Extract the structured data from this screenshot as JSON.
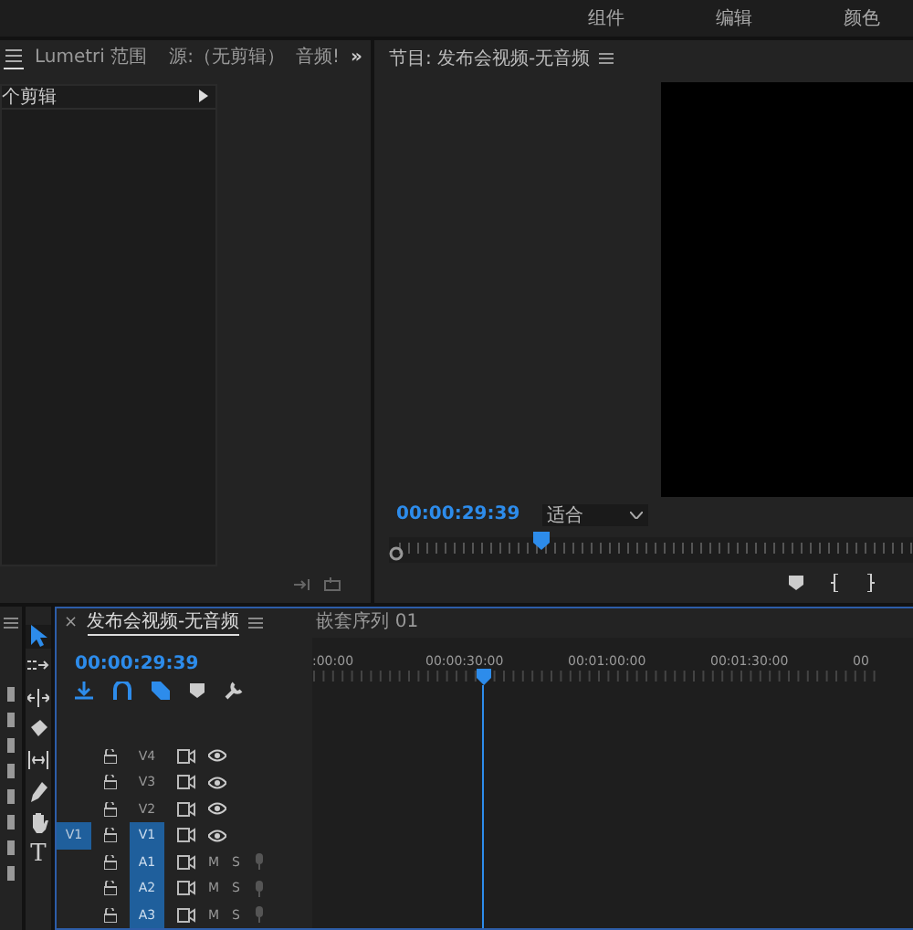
{
  "workspace_tabs": [
    "组件",
    "编辑",
    "颜色"
  ],
  "left_panel": {
    "tabs": [
      {
        "kind": "menu",
        "selected": true
      },
      {
        "kind": "text",
        "label": "Lumetri 范围",
        "selected": false
      },
      {
        "kind": "text",
        "label": "源:（无剪辑）",
        "selected": false
      },
      {
        "kind": "text",
        "label": "音频!",
        "selected": false
      }
    ],
    "overflow": "»",
    "list_header": "个剪辑"
  },
  "program": {
    "title": "节目: 发布会视频-无音频",
    "timecode": "00:00:29:39",
    "zoom": "适合",
    "playhead": {
      "level": 0.29
    }
  },
  "tools": [
    {
      "kind": "select",
      "selected": true
    },
    {
      "kind": "track",
      "selected": false
    },
    {
      "kind": "ripple",
      "selected": false
    },
    {
      "kind": "razor",
      "selected": false
    },
    {
      "kind": "slip",
      "selected": false
    },
    {
      "kind": "pen",
      "selected": false
    },
    {
      "kind": "hand",
      "selected": false
    },
    {
      "kind": "type",
      "glyph": "T",
      "selected": false
    }
  ],
  "timeline": {
    "tabs": [
      {
        "label": "发布会视频-无音频",
        "selected": true,
        "close": "×"
      },
      {
        "label": "嵌套序列 01",
        "selected": false
      }
    ],
    "timecode": "00:00:29:39",
    "ruler": [
      ":00:00",
      "00:00:30:00",
      "00:01:00:00",
      "00:01:30:00",
      "00"
    ],
    "playhead": {
      "level": 0.25
    },
    "tracks": [
      {
        "kind": "video",
        "label": "V4",
        "targeted": false
      },
      {
        "kind": "video",
        "label": "V3",
        "targeted": false
      },
      {
        "kind": "video",
        "label": "V2",
        "targeted": false
      },
      {
        "kind": "video",
        "label": "V1",
        "targeted": true,
        "source_patch": "V1"
      },
      {
        "kind": "audio",
        "label": "A1",
        "targeted": true,
        "mute": "M",
        "solo": "S"
      },
      {
        "kind": "audio",
        "label": "A2",
        "targeted": true,
        "mute": "M",
        "solo": "S"
      },
      {
        "kind": "audio",
        "label": "A3",
        "targeted": true,
        "mute": "M",
        "solo": "S"
      }
    ]
  }
}
